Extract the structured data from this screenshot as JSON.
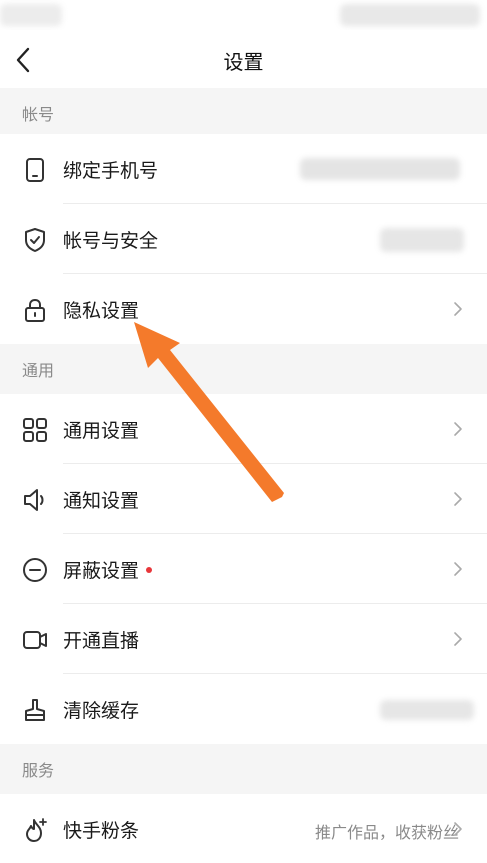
{
  "header": {
    "title": "设置"
  },
  "sections": {
    "account": "帐号",
    "general": "通用",
    "service": "服务"
  },
  "rows": {
    "bind_phone": "绑定手机号",
    "account_security": "帐号与安全",
    "privacy": "隐私设置",
    "general_settings": "通用设置",
    "notification": "通知设置",
    "block": "屏蔽设置",
    "live": "开通直播",
    "clear_cache": "清除缓存",
    "fan_bar": "快手粉条",
    "fan_bar_desc": "推广作品，收获粉丝"
  },
  "colors": {
    "accent_arrow": "#f47a2b",
    "badge_dot": "#e8363a"
  },
  "icons": {
    "back": "chevron-left-icon",
    "bind_phone": "phone-icon",
    "account_security": "shield-check-icon",
    "privacy": "lock-icon",
    "general_settings": "grid-icon",
    "notification": "speaker-icon",
    "block": "minus-circle-icon",
    "live": "video-camera-icon",
    "clear_cache": "broom-icon",
    "fan_bar": "fire-plus-icon"
  }
}
